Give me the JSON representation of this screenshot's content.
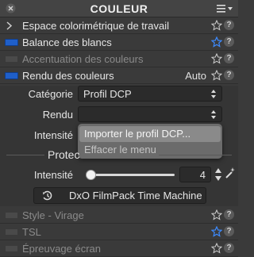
{
  "header": {
    "title": "COULEUR"
  },
  "sections": [
    {
      "label": "Espace colorimétrique de travail",
      "state": "collapsed"
    },
    {
      "label": "Balance des blancs",
      "toggle": "on",
      "star": "blue"
    },
    {
      "label": "Accentuation des couleurs",
      "toggle": "off",
      "dimmed": true
    },
    {
      "label": "Rendu des couleurs",
      "toggle": "on",
      "right_text": "Auto"
    }
  ],
  "rendu": {
    "categorie_label": "Catégorie",
    "categorie_value": "Profil DCP",
    "rendu_label": "Rendu",
    "rendu_value": "",
    "intensite_label": "Intensité"
  },
  "popup": {
    "items": [
      "Importer le profil DCP...",
      "Effacer le menu"
    ],
    "highlighted": 0
  },
  "protection": {
    "label": "Protec",
    "intensite_label": "Intensité",
    "intensite_value": "4",
    "slider_fraction": 0.04
  },
  "time_machine_button": "DxO FilmPack Time Machine",
  "bottom_sections": [
    {
      "label": "Style - Virage",
      "toggle": "off",
      "dimmed": true
    },
    {
      "label": "TSL",
      "toggle": "off",
      "dimmed": true,
      "star": "blue"
    },
    {
      "label": "Épreuvage écran",
      "toggle": "off",
      "dimmed": true
    }
  ],
  "colors": {
    "accent": "#1f5fc9",
    "star_blue": "#3d8bff",
    "panel": "#3a3a3a"
  }
}
